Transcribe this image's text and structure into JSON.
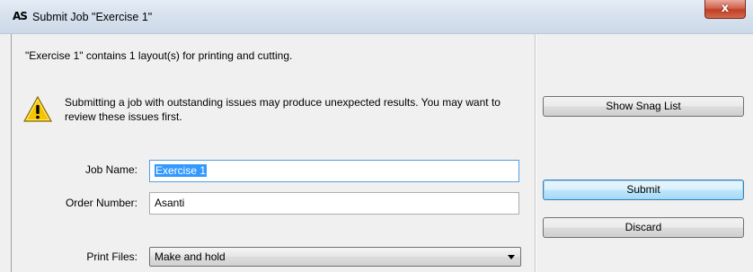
{
  "window": {
    "logo_text": "AS",
    "title": "Submit Job \"Exercise 1\"",
    "close_label": "x"
  },
  "info": {
    "text": "\"Exercise 1\" contains 1 layout(s) for printing and cutting."
  },
  "warning": {
    "icon": "warning-triangle-icon",
    "text": "Submitting a job with outstanding issues may produce unexpected results. You may want to review these issues first."
  },
  "form": {
    "job_name_label": "Job Name:",
    "job_name_value": "Exercise 1",
    "order_number_label": "Order Number:",
    "order_number_value": "Asanti",
    "print_files_label": "Print Files:",
    "print_files_value": "Make and hold"
  },
  "buttons": {
    "show_snag_list": "Show Snag List",
    "submit": "Submit",
    "discard": "Discard"
  },
  "colors": {
    "accent_selection": "#3399ff",
    "close_button": "#c23f26",
    "warning_yellow": "#f5c400"
  }
}
